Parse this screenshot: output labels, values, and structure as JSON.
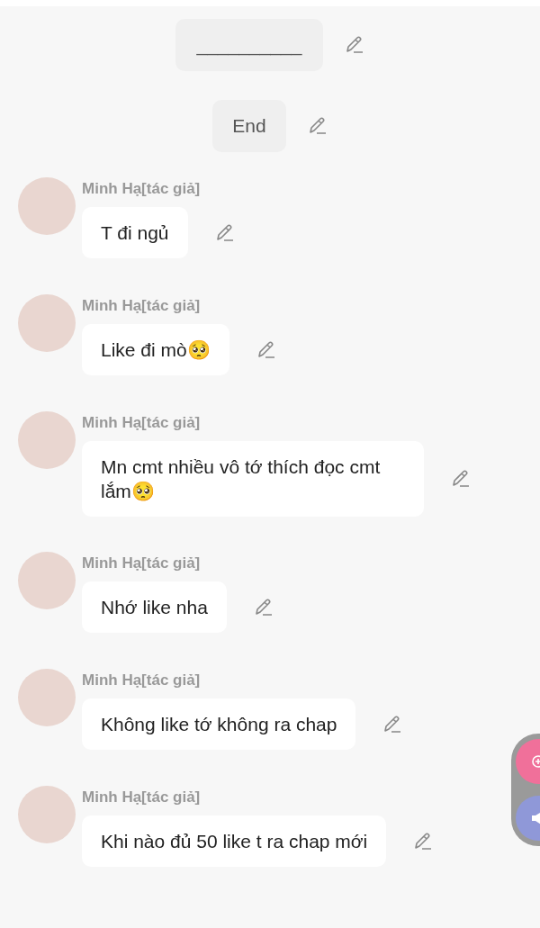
{
  "system_messages": [
    {
      "text": "__________"
    },
    {
      "text": "End"
    }
  ],
  "messages": [
    {
      "author": "Minh Hạ[tác giả]",
      "text": "T đi ngủ"
    },
    {
      "author": "Minh Hạ[tác giả]",
      "text": "Like đi mò🥺"
    },
    {
      "author": "Minh Hạ[tác giả]",
      "text": "Mn cmt nhiều vô tớ thích đọc cmt lắm🥺"
    },
    {
      "author": "Minh Hạ[tác giả]",
      "text": "Nhớ like nha"
    },
    {
      "author": "Minh Hạ[tác giả]",
      "text": "Không like tớ không ra chap"
    },
    {
      "author": "Minh Hạ[tác giả]",
      "text": "Khi nào đủ 50 like t ra chap mới"
    }
  ]
}
